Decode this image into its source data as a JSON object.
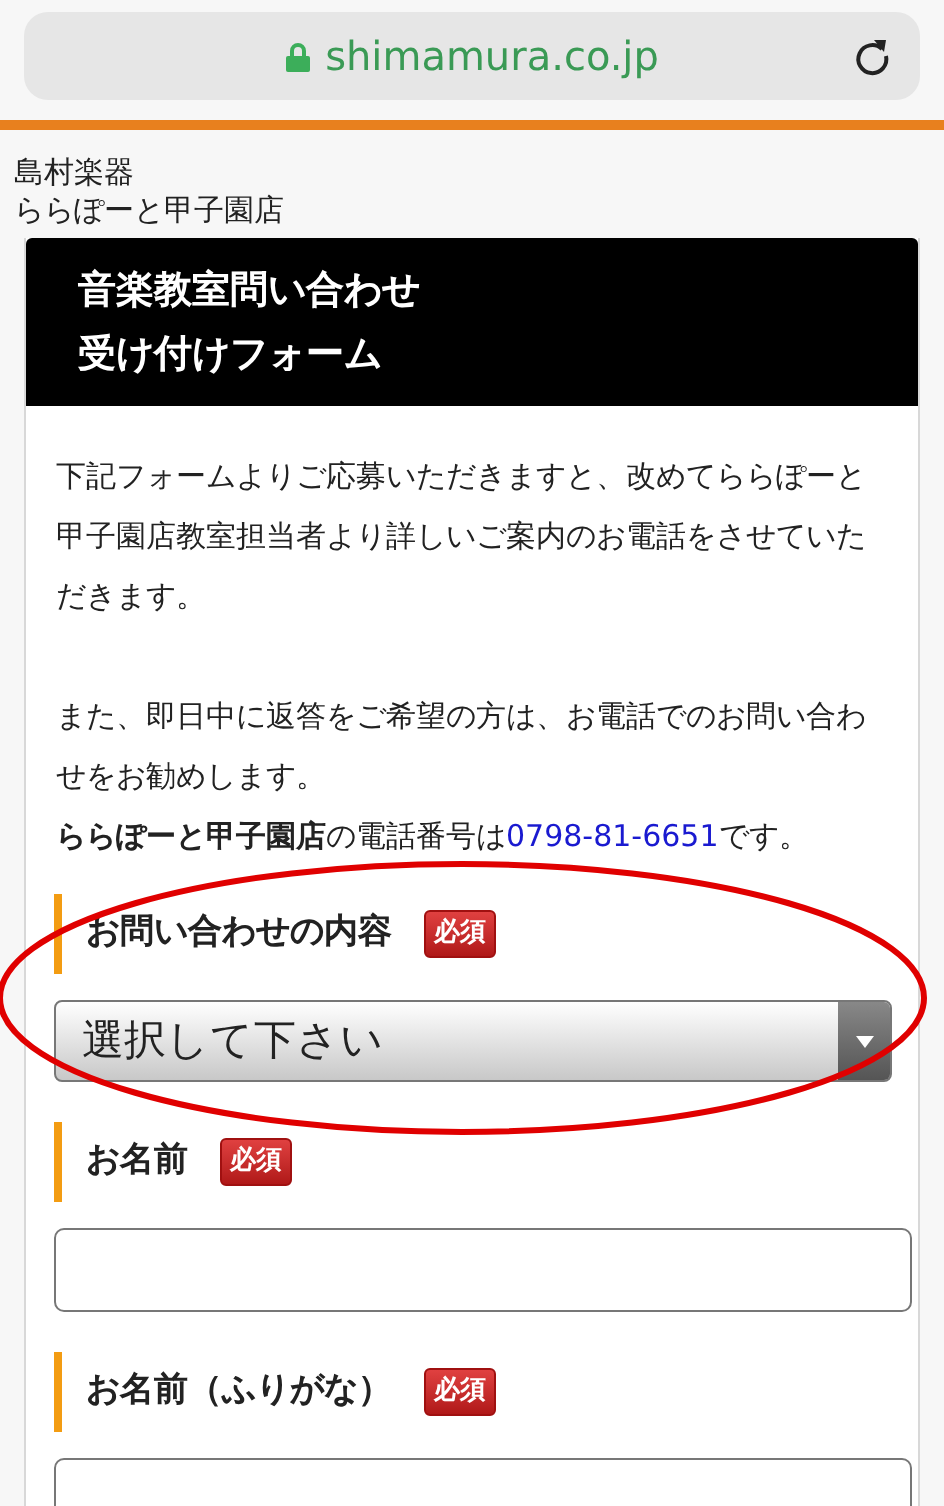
{
  "browser": {
    "url": "shimamura.co.jp"
  },
  "store": {
    "brand": "島村楽器",
    "branch": "ららぽーと甲子園店"
  },
  "header": {
    "lines": [
      "音楽教室問い合わせ",
      "受け付けフォーム"
    ]
  },
  "intro": [
    "下記フォームよりご応募いただきますと、改めてららぽーと甲子園店教室担当者より詳しいご案内のお電話をさせていただきます。",
    "また、即日中に返答をご希望の方は、お電話でのお問い合わせをお勧めします。"
  ],
  "phone_line": {
    "prefix": "**ららぽーと甲子園店**の電話番号は",
    "number": "0798-81-6651",
    "suffix": "です。"
  },
  "fields": [
    {
      "kind": "select",
      "label": "お問い合わせの内容",
      "required": true,
      "badge": "必須",
      "value": "選択して下さい",
      "circled": true
    },
    {
      "kind": "text",
      "label": "お名前",
      "required": true,
      "badge": "必須",
      "circled": false
    },
    {
      "kind": "text",
      "label": "お名前（ふりがな）",
      "required": true,
      "badge": "必須",
      "circled": false
    }
  ]
}
